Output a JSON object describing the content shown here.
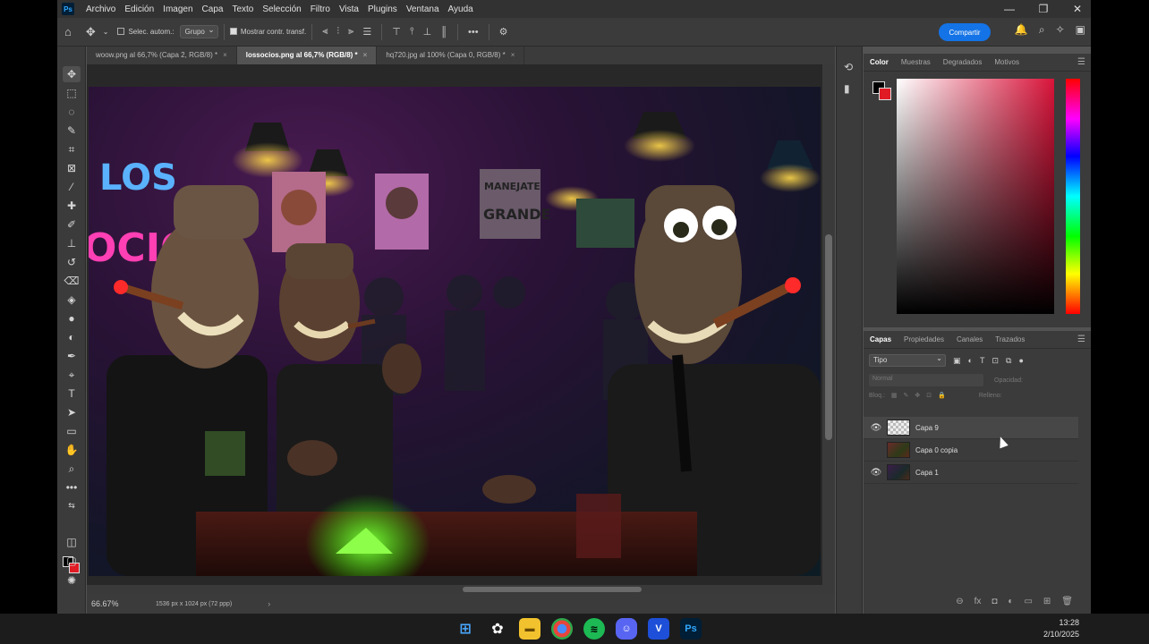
{
  "menubar": {
    "logo": "Ps",
    "items": [
      "Archivo",
      "Edición",
      "Imagen",
      "Capa",
      "Texto",
      "Selección",
      "Filtro",
      "Vista",
      "Plugins",
      "Ventana",
      "Ayuda"
    ],
    "window_controls": [
      "—",
      "❐",
      "✕"
    ]
  },
  "options_bar": {
    "auto_select_label": "Selec. autom.:",
    "group_value": "Grupo",
    "show_transform_label": "Mostrar contr. transf.",
    "share_label": "Compartir"
  },
  "tabs": [
    {
      "label": "woow.png al 66,7% (Capa 2, RGB/8) *",
      "active": false
    },
    {
      "label": "lossocios.png al 66,7% (RGB/8) *",
      "active": true
    },
    {
      "label": "hq720.jpg al 100% (Capa 0, RGB/8) *",
      "active": false
    }
  ],
  "status": {
    "zoom": "66.67%",
    "dimensions": "1536 px x 1024 px (72 ppp)",
    "arrow": "›"
  },
  "artwork": {
    "neon_sign_text": "LOS",
    "neon_sign_text2": "OCIO",
    "poster_text_1": "MANEJATE",
    "poster_text_2": "GRANDE"
  },
  "color_panel": {
    "tabs": [
      "Color",
      "Muestras",
      "Degradados",
      "Motivos"
    ],
    "foreground": "#000000",
    "background": "#e01b24"
  },
  "layers_panel": {
    "tabs": [
      "Capas",
      "Propiedades",
      "Canales",
      "Trazados"
    ],
    "filter_value": "Tipo",
    "blend_mode": "Normal",
    "opacity_label": "Opacidad:",
    "lock_label": "Bloq.:",
    "fill_label": "Relleno:",
    "layers": [
      {
        "name": "Capa 9",
        "visible": true,
        "thumb": "transparent"
      },
      {
        "name": "Capa 0 copia",
        "visible": false,
        "thumb": "art"
      },
      {
        "name": "Capa 1",
        "visible": true,
        "thumb": "art2"
      }
    ]
  },
  "taskbar": {
    "time": "13:28",
    "date": "2/10/2025"
  }
}
